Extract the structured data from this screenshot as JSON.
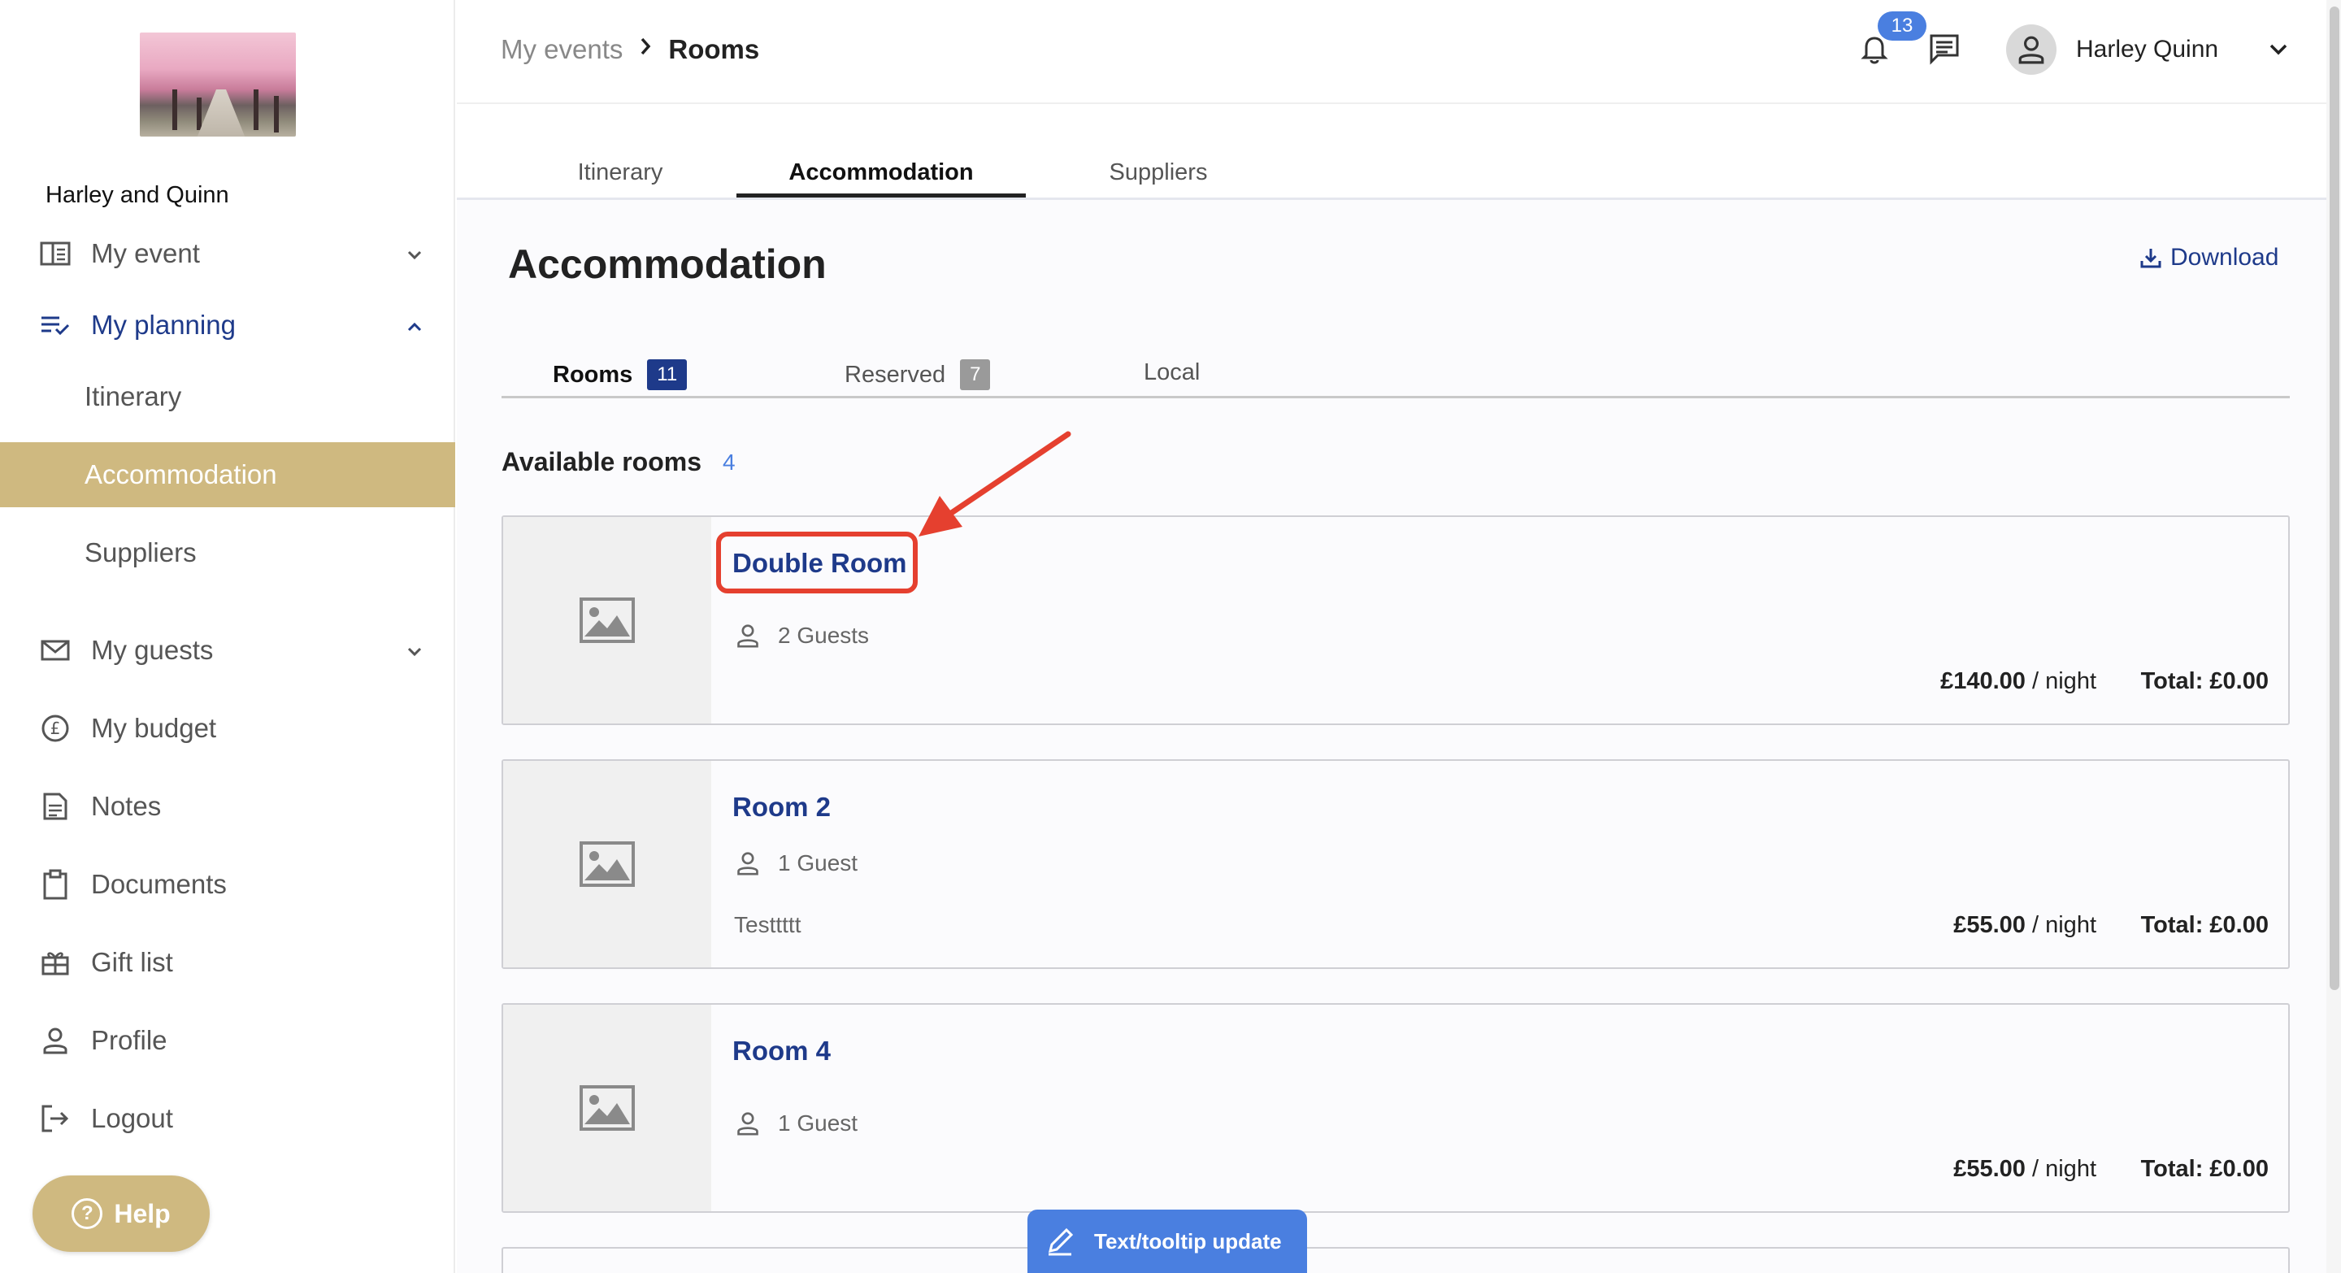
{
  "sidebar": {
    "event_name": "Harley and Quinn",
    "nav": [
      {
        "label": "My event",
        "icon": "book-icon"
      },
      {
        "label": "My planning",
        "icon": "checklist-icon"
      },
      {
        "label": "My guests",
        "icon": "mail-icon"
      },
      {
        "label": "My budget",
        "icon": "pound-icon"
      },
      {
        "label": "Notes",
        "icon": "notes-icon"
      },
      {
        "label": "Documents",
        "icon": "clipboard-icon"
      },
      {
        "label": "Gift list",
        "icon": "gift-icon"
      },
      {
        "label": "Profile",
        "icon": "person-icon"
      },
      {
        "label": "Logout",
        "icon": "logout-icon"
      }
    ],
    "planning_sub": [
      "Itinerary",
      "Accommodation",
      "Suppliers"
    ],
    "help_label": "Help"
  },
  "header": {
    "breadcrumb": [
      "My events",
      "Rooms"
    ],
    "notification_count": "13",
    "user_name": "Harley Quinn"
  },
  "main_tabs": [
    "Itinerary",
    "Accommodation",
    "Suppliers"
  ],
  "page": {
    "title": "Accommodation",
    "download_label": "Download",
    "subtabs": [
      {
        "label": "Rooms",
        "count": "11"
      },
      {
        "label": "Reserved",
        "count": "7"
      },
      {
        "label": "Local"
      }
    ],
    "section_title": "Available rooms",
    "section_count": "4",
    "rooms": [
      {
        "name": "Double Room",
        "guests": "2 Guests",
        "desc": "",
        "price": "£140.00",
        "per": "/ night",
        "total": "Total: £0.00"
      },
      {
        "name": "Room 2",
        "guests": "1 Guest",
        "desc": "Testtttt",
        "price": "£55.00",
        "per": "/ night",
        "total": "Total: £0.00"
      },
      {
        "name": "Room 4",
        "guests": "1 Guest",
        "desc": "",
        "price": "£55.00",
        "per": "/ night",
        "total": "Total: £0.00"
      }
    ]
  },
  "toast": {
    "label": "Text/tooltip update"
  },
  "colors": {
    "accent_gold": "#cfb980",
    "link_blue": "#1e3a8a",
    "badge_blue": "#4a7fe0",
    "annotation_red": "#e5402f"
  }
}
